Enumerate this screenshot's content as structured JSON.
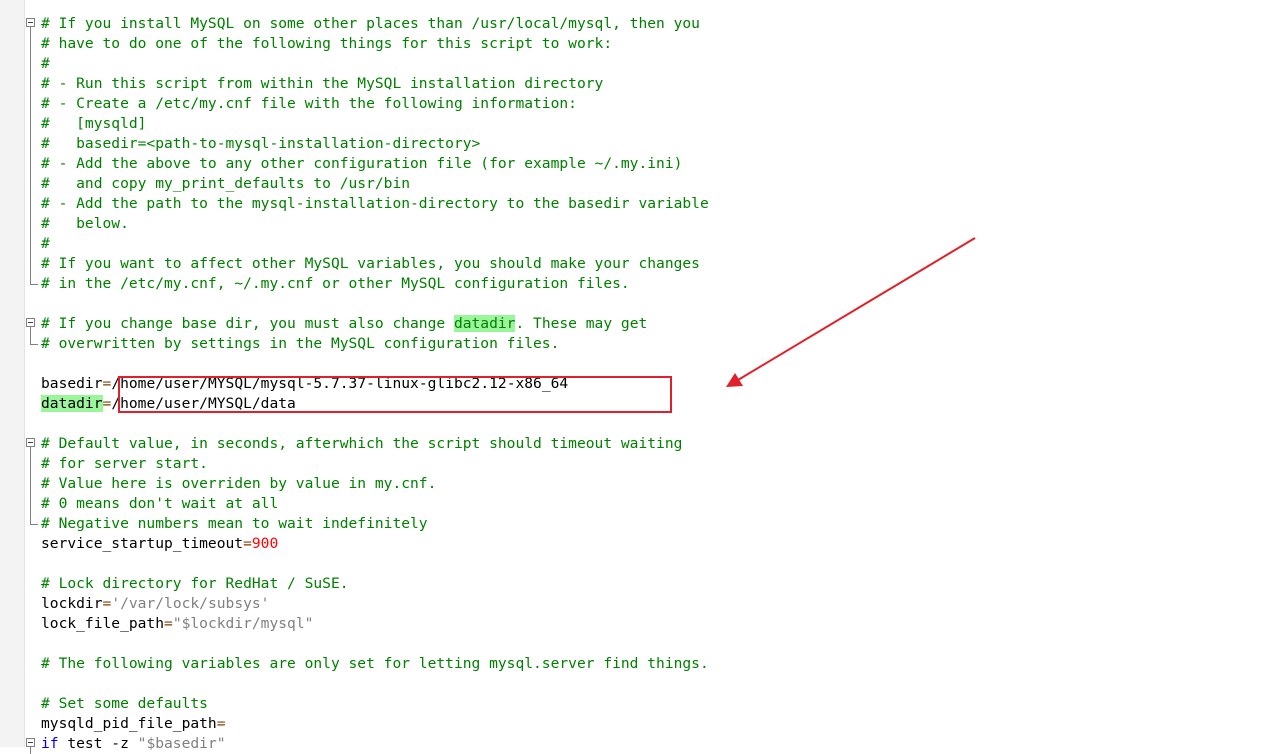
{
  "code_lines": [
    {
      "fold": "start",
      "segments": [
        {
          "t": "# If you install MySQL on some other places than /usr/local/mysql, then you",
          "c": "c"
        }
      ]
    },
    {
      "fold": "mid",
      "segments": [
        {
          "t": "# have to do one of the following things for this script to work:",
          "c": "c"
        }
      ]
    },
    {
      "fold": "mid",
      "segments": [
        {
          "t": "#",
          "c": "c"
        }
      ]
    },
    {
      "fold": "mid",
      "segments": [
        {
          "t": "# - Run this script from within the MySQL installation directory",
          "c": "c"
        }
      ]
    },
    {
      "fold": "mid",
      "segments": [
        {
          "t": "# - Create a /etc/my.cnf file with the following information:",
          "c": "c"
        }
      ]
    },
    {
      "fold": "mid",
      "segments": [
        {
          "t": "#   [mysqld]",
          "c": "c"
        }
      ]
    },
    {
      "fold": "mid",
      "segments": [
        {
          "t": "#   basedir=<path-to-mysql-installation-directory>",
          "c": "c"
        }
      ]
    },
    {
      "fold": "mid",
      "segments": [
        {
          "t": "# - Add the above to any other configuration file (for example ~/.my.ini)",
          "c": "c"
        }
      ]
    },
    {
      "fold": "mid",
      "segments": [
        {
          "t": "#   and copy my_print_defaults to /usr/bin",
          "c": "c"
        }
      ]
    },
    {
      "fold": "mid",
      "segments": [
        {
          "t": "# - Add the path to the mysql-installation-directory to the basedir variable",
          "c": "c"
        }
      ]
    },
    {
      "fold": "mid",
      "segments": [
        {
          "t": "#   below.",
          "c": "c"
        }
      ]
    },
    {
      "fold": "mid",
      "segments": [
        {
          "t": "#",
          "c": "c"
        }
      ]
    },
    {
      "fold": "mid",
      "segments": [
        {
          "t": "# If you want to affect other MySQL variables, you should make your changes",
          "c": "c"
        }
      ]
    },
    {
      "fold": "end",
      "segments": [
        {
          "t": "# in the /etc/my.cnf, ~/.my.cnf or other MySQL configuration files.",
          "c": "c"
        }
      ]
    },
    {
      "fold": "",
      "segments": []
    },
    {
      "fold": "start",
      "segments": [
        {
          "t": "# If you change base dir, you must also change ",
          "c": "c"
        },
        {
          "t": "datadir",
          "c": "c hl"
        },
        {
          "t": ". These may get",
          "c": "c"
        }
      ]
    },
    {
      "fold": "end",
      "segments": [
        {
          "t": "# overwritten by settings in the MySQL configuration files.",
          "c": "c"
        }
      ]
    },
    {
      "fold": "",
      "segments": []
    },
    {
      "fold": "",
      "segments": [
        {
          "t": "basedir",
          "c": "v"
        },
        {
          "t": "=",
          "c": "op"
        },
        {
          "t": "/home/user/MYSQL/mysql-5.7.37-linux-glibc2.12-x86_64",
          "c": "v"
        }
      ]
    },
    {
      "fold": "",
      "segments": [
        {
          "t": "datadir",
          "c": "v hl"
        },
        {
          "t": "=",
          "c": "op"
        },
        {
          "t": "/home/user/MYSQL/data",
          "c": "v"
        }
      ]
    },
    {
      "fold": "",
      "segments": []
    },
    {
      "fold": "start",
      "segments": [
        {
          "t": "# Default value, in seconds, afterwhich the script should timeout waiting",
          "c": "c"
        }
      ]
    },
    {
      "fold": "mid",
      "segments": [
        {
          "t": "# for server start.",
          "c": "c"
        }
      ]
    },
    {
      "fold": "mid",
      "segments": [
        {
          "t": "# Value here is overriden by value in my.cnf.",
          "c": "c"
        }
      ]
    },
    {
      "fold": "mid",
      "segments": [
        {
          "t": "# 0 means don't wait at all",
          "c": "c"
        }
      ]
    },
    {
      "fold": "end",
      "segments": [
        {
          "t": "# Negative numbers mean to wait indefinitely",
          "c": "c"
        }
      ]
    },
    {
      "fold": "",
      "segments": [
        {
          "t": "service_startup_timeout",
          "c": "v"
        },
        {
          "t": "=",
          "c": "op"
        },
        {
          "t": "900",
          "c": "num"
        }
      ]
    },
    {
      "fold": "",
      "segments": []
    },
    {
      "fold": "",
      "segments": [
        {
          "t": "# Lock directory for RedHat / SuSE.",
          "c": "c"
        }
      ]
    },
    {
      "fold": "",
      "segments": [
        {
          "t": "lockdir",
          "c": "v"
        },
        {
          "t": "=",
          "c": "op"
        },
        {
          "t": "'/var/lock/subsys'",
          "c": "str"
        }
      ]
    },
    {
      "fold": "",
      "segments": [
        {
          "t": "lock_file_path",
          "c": "v"
        },
        {
          "t": "=",
          "c": "op"
        },
        {
          "t": "\"$lockdir/mysql\"",
          "c": "str"
        }
      ]
    },
    {
      "fold": "",
      "segments": []
    },
    {
      "fold": "",
      "segments": [
        {
          "t": "# The following variables are only set for letting mysql.server find things.",
          "c": "c"
        }
      ]
    },
    {
      "fold": "",
      "segments": []
    },
    {
      "fold": "",
      "segments": [
        {
          "t": "# Set some defaults",
          "c": "c"
        }
      ]
    },
    {
      "fold": "",
      "segments": [
        {
          "t": "mysqld_pid_file_path",
          "c": "v"
        },
        {
          "t": "=",
          "c": "op"
        }
      ]
    },
    {
      "fold": "start",
      "segments": [
        {
          "t": "if",
          "c": "kw"
        },
        {
          "t": " test -z ",
          "c": "v"
        },
        {
          "t": "\"$basedir\"",
          "c": "str"
        }
      ]
    }
  ],
  "annotation": {
    "box_color": "#e0202a",
    "arrow_color": "#e0202a"
  }
}
